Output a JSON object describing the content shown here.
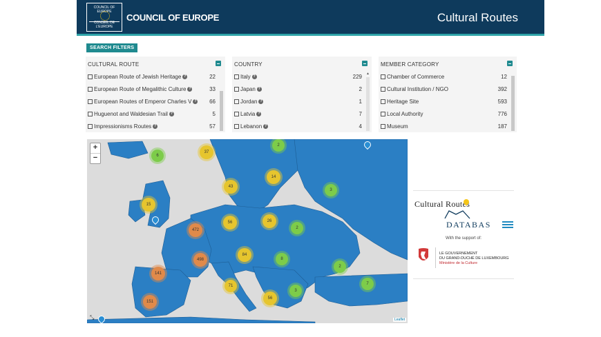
{
  "header": {
    "logo_top": "COUNCIL OF EUROPE",
    "logo_bottom": "CONSEIL DE L'EUROPE",
    "brand": "COUNCIL OF EUROPE",
    "site_title": "Cultural Routes"
  },
  "filters_button": "SEARCH FILTERS",
  "panels": {
    "route": {
      "title": "CULTURAL ROUTE",
      "items": [
        {
          "label": "European Route of Jewish Heritage",
          "count": "22"
        },
        {
          "label": "European Route of Megalithic Culture",
          "count": "33"
        },
        {
          "label": "European Routes of Emperor Charles V",
          "count": "66"
        },
        {
          "label": "Huguenot and Waldesian Trail",
          "count": "5"
        },
        {
          "label": "Impressionisms Routes",
          "count": "57"
        }
      ]
    },
    "country": {
      "title": "COUNTRY",
      "items": [
        {
          "label": "Italy",
          "count": "229"
        },
        {
          "label": "Japan",
          "count": "2"
        },
        {
          "label": "Jordan",
          "count": "1"
        },
        {
          "label": "Latvia",
          "count": "7"
        },
        {
          "label": "Lebanon",
          "count": "4"
        }
      ]
    },
    "member": {
      "title": "MEMBER CATEGORY",
      "items": [
        {
          "label": "Chamber of Commerce",
          "count": "12"
        },
        {
          "label": "Cultural Institution / NGO",
          "count": "392"
        },
        {
          "label": "Heritage Site",
          "count": "593"
        },
        {
          "label": "Local Authority",
          "count": "776"
        },
        {
          "label": "Museum",
          "count": "187"
        }
      ]
    }
  },
  "map": {
    "zoom_in": "+",
    "zoom_out": "−",
    "attribution": "Leaflet",
    "clusters": [
      "6",
      "37",
      "2",
      "43",
      "14",
      "3",
      "15",
      "472",
      "56",
      "26",
      "2",
      "498",
      "84",
      "8",
      "2",
      "141",
      "71",
      "3",
      "7",
      "151",
      "56"
    ]
  },
  "side": {
    "cultural_routes": "Cultural Routes",
    "database": "DATABAS",
    "support": "With the support of:",
    "lux_line1": "LE GOUVERNEMENT",
    "lux_line2": "DU GRAND-DUCHÉ DE LUXEMBOURG",
    "lux_line3": "Ministère de la Culture"
  }
}
